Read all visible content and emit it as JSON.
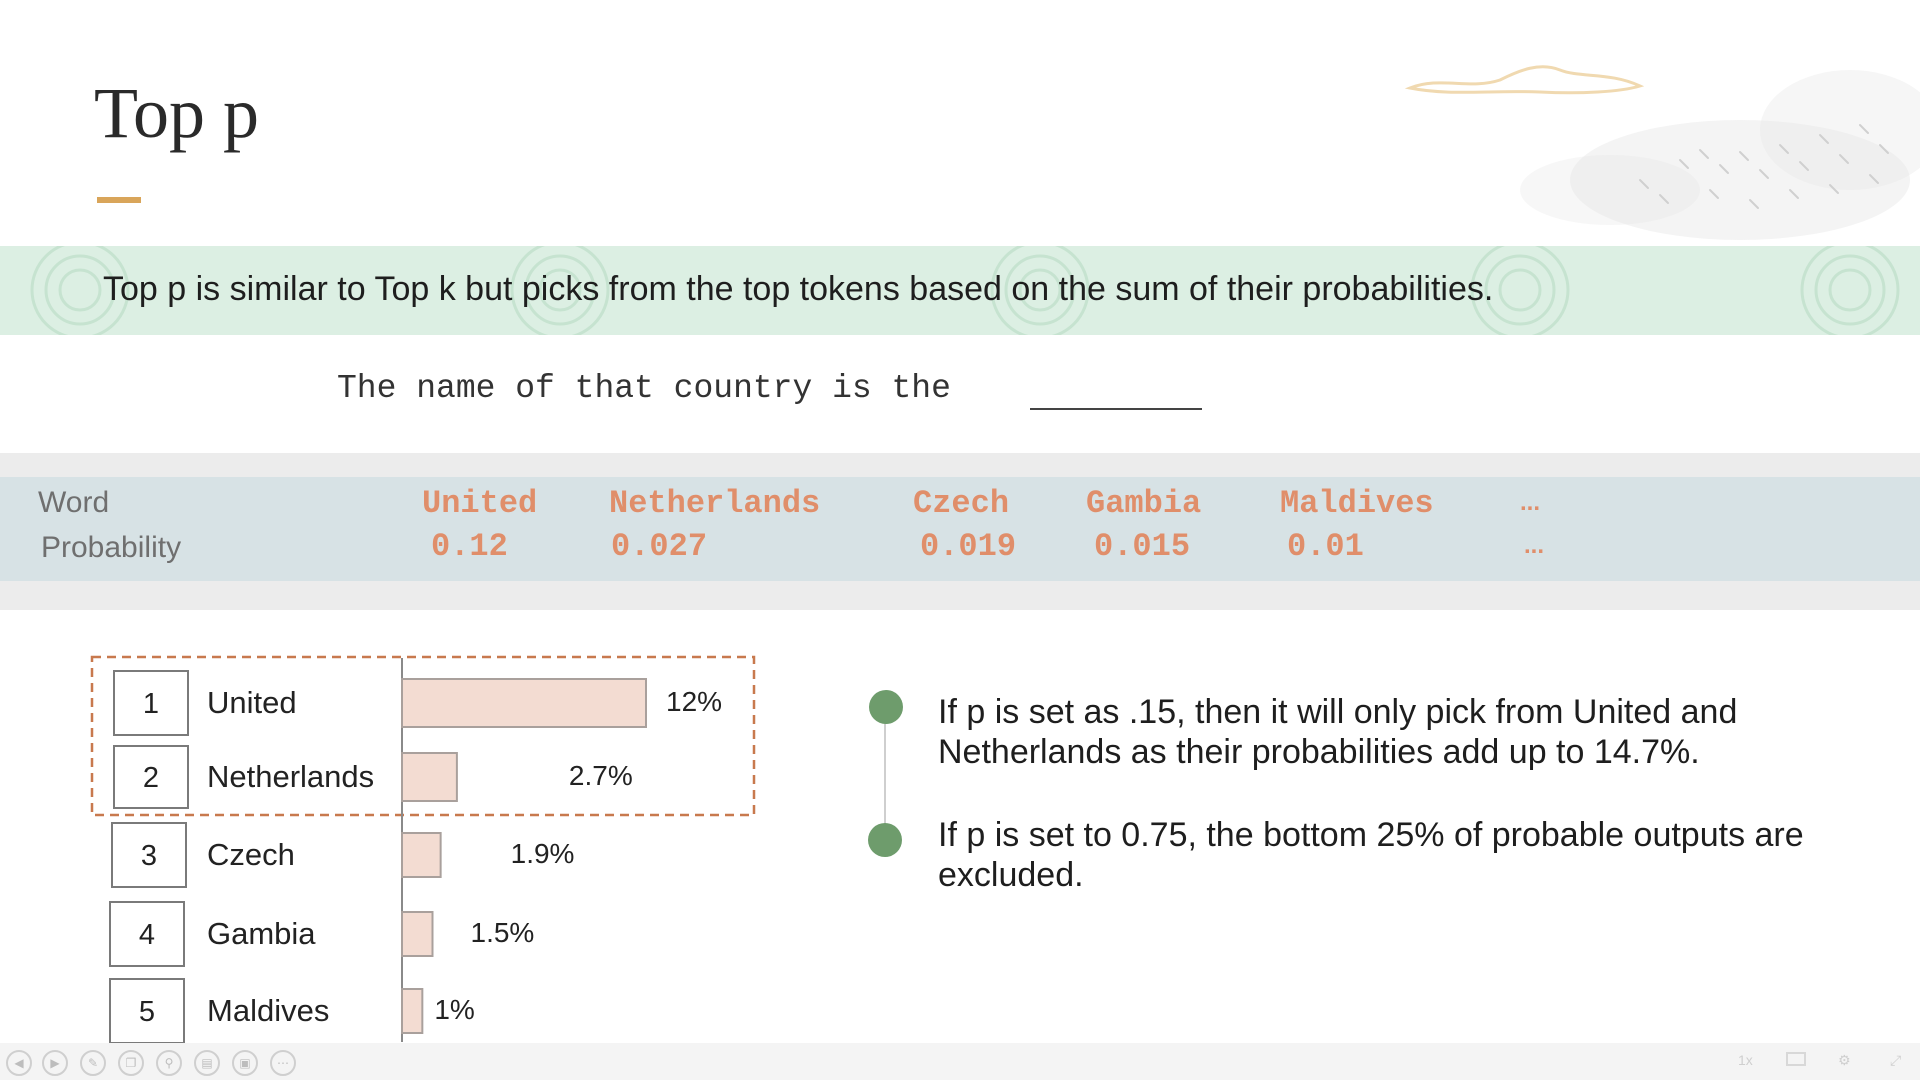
{
  "slide": {
    "title": "Top p",
    "banner": "Top p is similar to Top k but picks from the top tokens based on the sum of their probabilities.",
    "sentence": "The name of that country is the"
  },
  "table": {
    "row_labels": {
      "word": "Word",
      "probability": "Probability"
    },
    "words": [
      "United",
      "Netherlands",
      "Czech",
      "Gambia",
      "Maldives"
    ],
    "probabilities": [
      "0.12",
      "0.027",
      "0.019",
      "0.015",
      "0.01"
    ],
    "ellipsis": "..."
  },
  "chart_data": {
    "type": "bar",
    "orientation": "horizontal",
    "ranks": [
      "1",
      "2",
      "3",
      "4",
      "5"
    ],
    "categories": [
      "United",
      "Netherlands",
      "Czech",
      "Gambia",
      "Maldives"
    ],
    "values": [
      12,
      2.7,
      1.9,
      1.5,
      1
    ],
    "value_labels": [
      "12%",
      "2.7%",
      "1.9%",
      "1.5%",
      "1%"
    ],
    "highlighted": [
      "United",
      "Netherlands"
    ],
    "bar_color": "#f3dcd2",
    "bar_border": "#a9a09c",
    "highlight_border": "#c8794e"
  },
  "bullets": [
    "If p is set as .15, then it will only pick from United and Netherlands as their probabilities add up to 14.7%.",
    "If p is set to 0.75, the bottom 25% of probable outputs are excluded."
  ],
  "colors": {
    "accent": "#d9a55a",
    "banner_bg": "#dcefe3",
    "table_band": "#d7e2e5",
    "token_color": "#e08e6a",
    "bullet_dot": "#6e9c6c"
  },
  "toolbar": {
    "icons": [
      "prev-icon",
      "play-icon",
      "pen-icon",
      "copy-icon",
      "zoom-icon",
      "captions-icon",
      "camera-icon",
      "more-icon"
    ],
    "speed": "1x"
  }
}
